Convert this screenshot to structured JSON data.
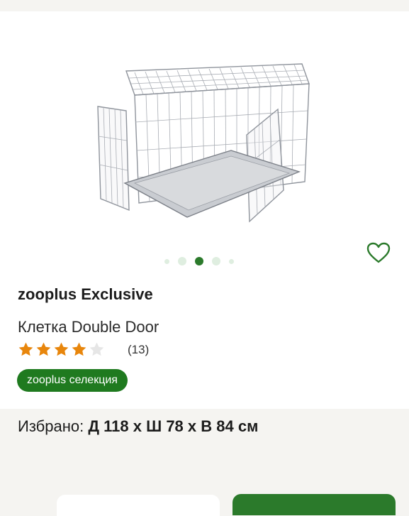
{
  "product": {
    "brand": "zooplus Exclusive",
    "name": "Клетка Double Door",
    "rating": 4,
    "rating_max": 5,
    "review_count": "(13)",
    "badge": "zooplus селекция"
  },
  "gallery": {
    "image": "dog-cage-image",
    "slide_count": 5,
    "active_slide": 3
  },
  "selection": {
    "label": "Избрано:",
    "value": "Д 118 x Ш 78 x В 84 см"
  },
  "colors": {
    "accent": "#1f7a1f",
    "star": "#e8860c",
    "star_empty": "#e6e6e6",
    "dot_inactive": "#dfeee0"
  },
  "icons": {
    "favorite": "heart-outline-icon",
    "star": "star-icon"
  }
}
